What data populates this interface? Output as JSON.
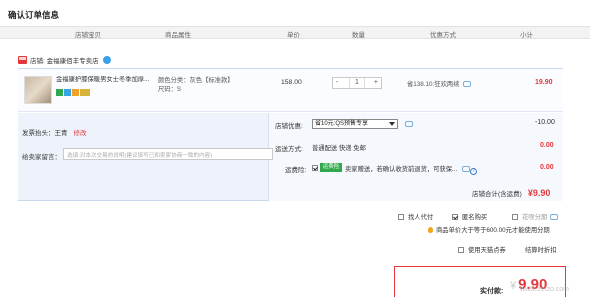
{
  "page_title": "确认订单信息",
  "columns": [
    "店铺宝贝",
    "商品属性",
    "单价",
    "数量",
    "优惠方式",
    "小计"
  ],
  "shop": {
    "label": "店铺:",
    "name": "金福康佰丰专卖店"
  },
  "item": {
    "name": "金福康护膝保暖男女士冬季加厚...",
    "sku_color": "颜色分类：灰色【标准款】",
    "sku_size": "尺码：S",
    "price": "158.00",
    "quantity": "1",
    "minus": "-",
    "plus": "+",
    "discount": "省138.10:狂欢两续",
    "subtotal": "19.90"
  },
  "invoice": {
    "label": "发票抬头：王青",
    "edit": "修改"
  },
  "message": {
    "label": "给卖家留言：",
    "placeholder": "选填:对本次交易的说明(建议填写已和卖家协商一致的内容)"
  },
  "coupon": {
    "label": "店铺优惠:",
    "selected": "省10元:QS预售专享",
    "amount": "-10.00"
  },
  "shipping": {
    "label": "运送方式:",
    "value": "普通配送 快递 免邮",
    "amount": "0.00"
  },
  "insurance": {
    "label": "运费险:",
    "badge": "运费险",
    "text": "卖家赠送，若确认收货前退货，可获保...",
    "help": "?",
    "amount": "0.00"
  },
  "shop_total": {
    "label": "店铺合计(含运费)",
    "amount": "¥9.90"
  },
  "options": {
    "proxy_pay": "找人代付",
    "anonymous": "匿名购买",
    "installment": "花呗分期",
    "installment_note": "商品单价大于等于600.00元才能使用分期",
    "tmall_coupon": "使用天猫点券",
    "combo_discount": "结算时折扣"
  },
  "payment": {
    "label": "实付款:",
    "yen": "¥",
    "amount": "9.90"
  },
  "watermark": "www.51cto.com"
}
